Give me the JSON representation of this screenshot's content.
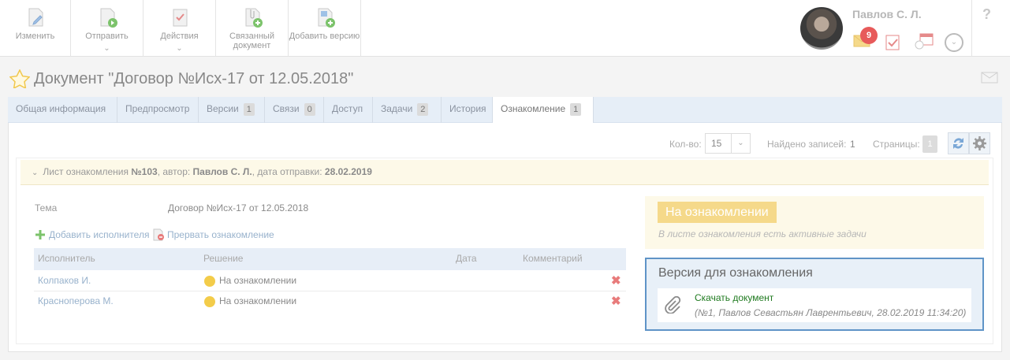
{
  "toolbar": {
    "buttons": [
      {
        "label": "Изменить"
      },
      {
        "label": "Отправить"
      },
      {
        "label": "Действия"
      },
      {
        "label": "Связанный документ"
      },
      {
        "label": "Добавить версию"
      }
    ]
  },
  "user": {
    "name": "Павлов С. Л.",
    "mail_count": "9"
  },
  "help_label": "?",
  "document": {
    "title": "Документ \"Договор №Исх-17 от 12.05.2018\""
  },
  "tabs": [
    {
      "label": "Общая информация",
      "count": ""
    },
    {
      "label": "Предпросмотр",
      "count": ""
    },
    {
      "label": "Версии",
      "count": "1"
    },
    {
      "label": "Связи",
      "count": "0"
    },
    {
      "label": "Доступ",
      "count": ""
    },
    {
      "label": "Задачи",
      "count": "2"
    },
    {
      "label": "История",
      "count": ""
    },
    {
      "label": "Ознакомление",
      "count": "1"
    }
  ],
  "pager": {
    "count_label": "Кол-во:",
    "count_value": "15",
    "found_label": "Найдено записей:",
    "found_value": "1",
    "pages_label": "Страницы:",
    "pages_value": "1"
  },
  "list_header": {
    "prefix": "Лист ознакомления",
    "number": "№103",
    "author_label": ", автор:",
    "author": "Павлов С. Л.",
    "date_label": ", дата отправки:",
    "date": "28.02.2019"
  },
  "topic": {
    "label": "Тема",
    "value": "Договор №Исх-17 от 12.05.2018"
  },
  "actions": {
    "add_executor": "Добавить исполнителя",
    "stop": "Прервать ознакомление"
  },
  "table": {
    "headers": [
      "Исполнитель",
      "Решение",
      "Дата",
      "Комментарий"
    ],
    "rows": [
      {
        "executor": "Колпаков И.",
        "decision": "На ознакомлении",
        "date": "",
        "comment": ""
      },
      {
        "executor": "Красноперова М.",
        "decision": "На ознакомлении",
        "date": "",
        "comment": ""
      }
    ]
  },
  "status": {
    "badge": "На ознакомлении",
    "note": "В листе ознакомления есть активные задачи"
  },
  "version": {
    "title": "Версия для ознакомления",
    "download": "Скачать документ",
    "meta": "(№1, Павлов Севастьян Лаврентьевич, 28.02.2019 11:34:20)"
  },
  "colors": {
    "accent_blue": "#5f94c7",
    "badge_red": "#e75a5a",
    "status_yellow": "#f5d98a",
    "link_green": "#1f7a1f"
  }
}
